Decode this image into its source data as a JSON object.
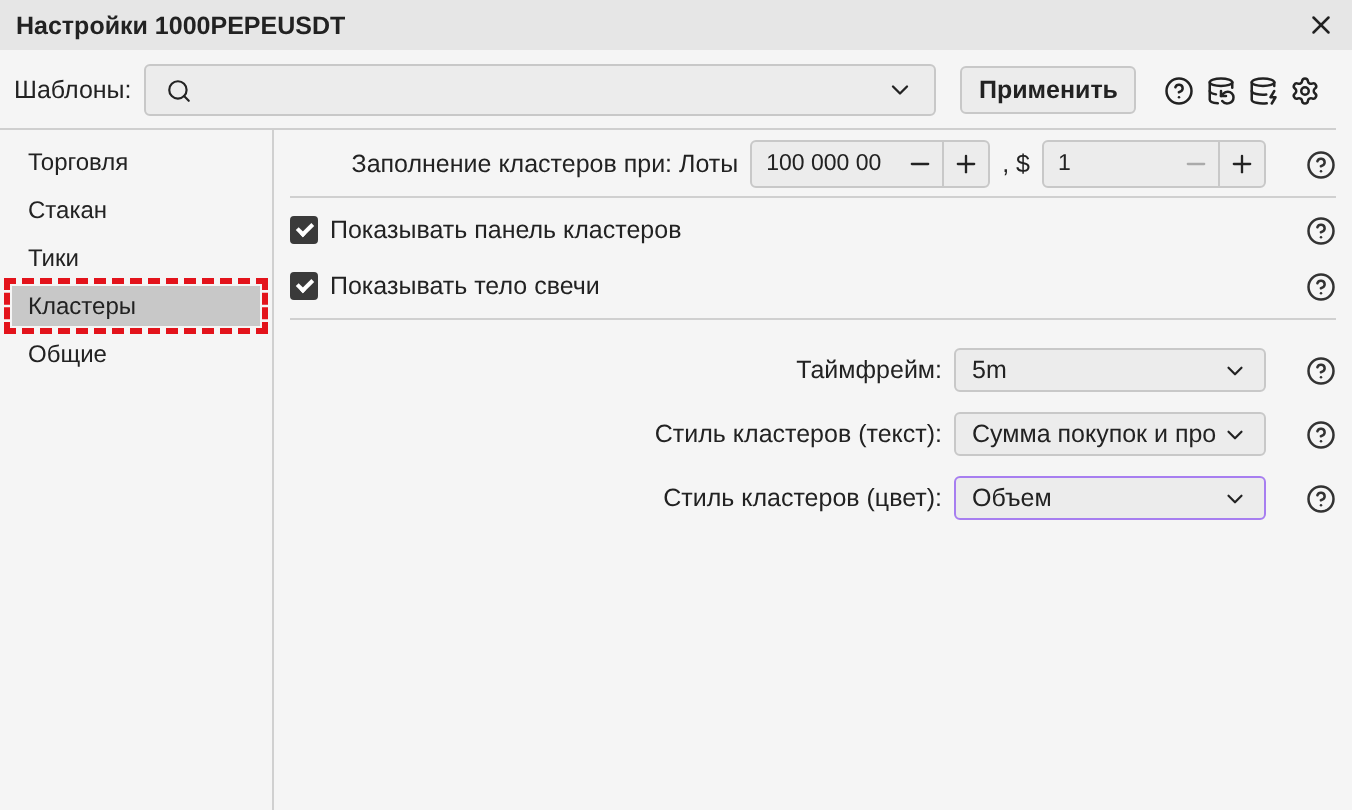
{
  "window": {
    "title": "Настройки 1000PEPEUSDT"
  },
  "templates": {
    "label": "Шаблоны:",
    "apply": "Применить"
  },
  "sidebar": {
    "items": [
      {
        "label": "Торговля",
        "selected": false
      },
      {
        "label": "Стакан",
        "selected": false
      },
      {
        "label": "Тики",
        "selected": false
      },
      {
        "label": "Кластеры",
        "selected": true
      },
      {
        "label": "Общие",
        "selected": false
      }
    ]
  },
  "fill": {
    "label": "Заполнение кластеров при: Лоты",
    "lots": "100 000 00",
    "sep": ", $",
    "usd": "1"
  },
  "checkboxes": [
    {
      "label": "Показывать панель кластеров",
      "checked": true
    },
    {
      "label": "Показывать тело свечи",
      "checked": true
    }
  ],
  "selects": [
    {
      "label": "Таймфрейм:",
      "value": "5m",
      "focused": false
    },
    {
      "label": "Стиль кластеров (текст):",
      "value": "Сумма покупок и про",
      "focused": false
    },
    {
      "label": "Стиль кластеров (цвет):",
      "value": "Объем",
      "focused": true
    }
  ]
}
